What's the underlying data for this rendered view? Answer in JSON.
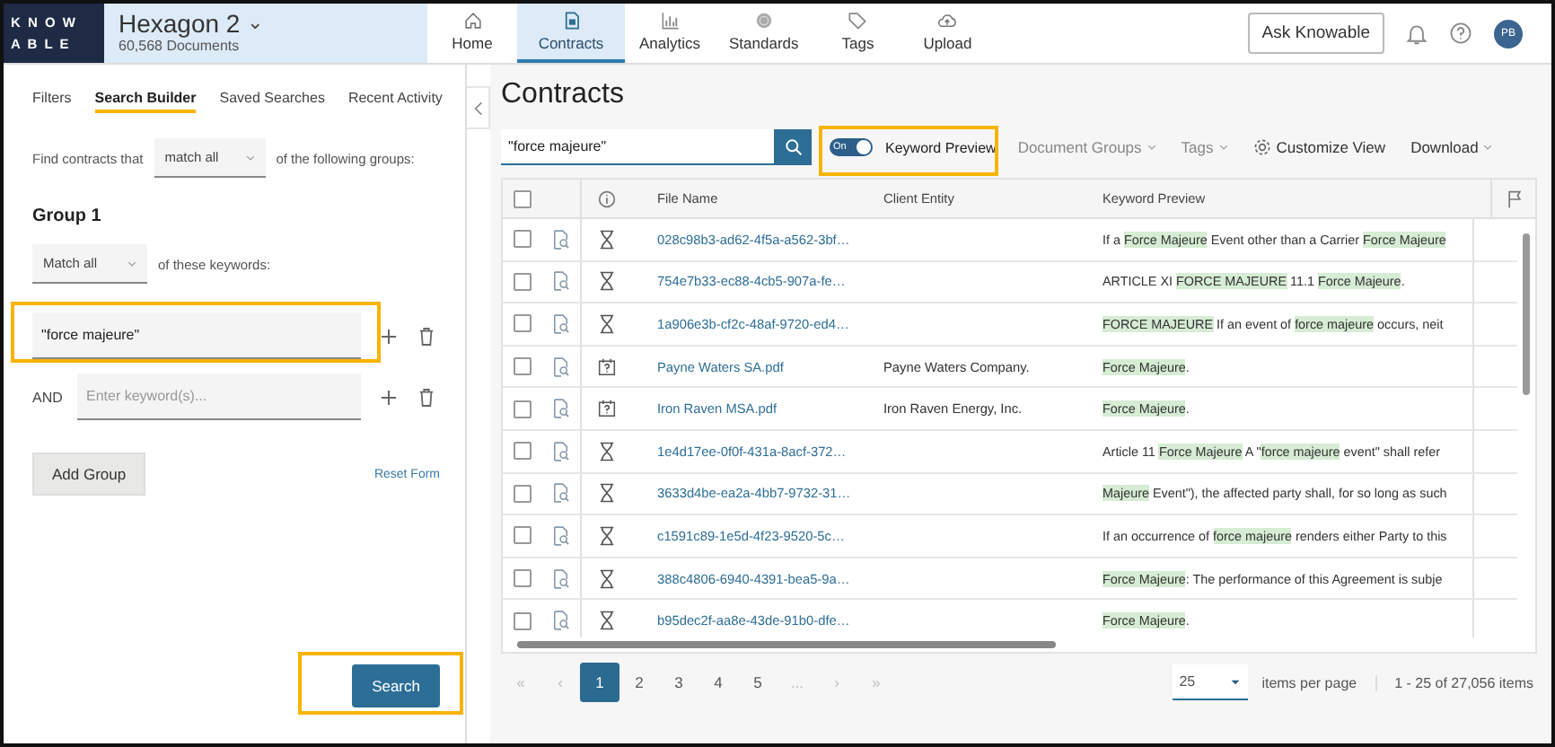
{
  "logo": {
    "line_1": "K N O W",
    "line_2": "A B L E"
  },
  "workspace": {
    "name": "Hexagon 2",
    "caret": "⌄",
    "documents": "60,568 Documents"
  },
  "nav": [
    {
      "label": "Home",
      "selected": false
    },
    {
      "label": "Contracts",
      "selected": true
    },
    {
      "label": "Analytics",
      "selected": false
    },
    {
      "label": "Standards",
      "selected": false
    },
    {
      "label": "Tags",
      "selected": false
    },
    {
      "label": "Upload",
      "selected": false
    }
  ],
  "ask_button": "Ask Knowable",
  "avatar": "PB",
  "left_tabs": [
    {
      "label": "Filters",
      "selected": false
    },
    {
      "label": "Search Builder",
      "selected": true
    },
    {
      "label": "Saved Searches",
      "selected": false
    },
    {
      "label": "Recent Activity",
      "selected": false
    }
  ],
  "find_row": {
    "before": "Find contracts that",
    "select": "match all",
    "after": "of the following groups:"
  },
  "group": {
    "title": "Group 1",
    "match_select": "Match all",
    "match_after": "of these keywords:",
    "keywords": [
      {
        "value": "\"force majeure\"",
        "annotated": true
      },
      {
        "prefix": "AND",
        "placeholder": "Enter keyword(s)..."
      }
    ]
  },
  "add_group": "Add Group",
  "reset_form": "Reset Form",
  "search_button": {
    "label": "Search",
    "annotated": true
  },
  "page_title": "Contracts",
  "search_field": {
    "value": "\"force majeure\""
  },
  "keyword_toggle": {
    "on": true,
    "state_label": "On",
    "label": "Keyword Preview",
    "annotated": true
  },
  "toolbar": [
    {
      "label": "Document Groups",
      "kind": "dropdown"
    },
    {
      "label": "Tags",
      "kind": "dropdown"
    },
    {
      "label": "Customize View",
      "kind": "settings"
    },
    {
      "label": "Download",
      "kind": "dropdown"
    }
  ],
  "table": {
    "columns": [
      "File Name",
      "Client Entity",
      "Keyword Preview"
    ],
    "select_all_checked": false,
    "rows": [
      {
        "kind": "hourglass",
        "checked": false,
        "file": "028c98b3-ad62-4f5a-a562-3bf…",
        "preview": [
          {
            "text": "If a ",
            "highlighted": false
          },
          {
            "text": "Force Majeure",
            "highlighted": true
          },
          {
            "text": " Event other than a Carrier ",
            "highlighted": false
          },
          {
            "text": "Force Majeure",
            "highlighted": true
          }
        ]
      },
      {
        "kind": "hourglass",
        "checked": false,
        "file": "754e7b33-ec88-4cb5-907a-fe…",
        "preview": [
          {
            "text": "ARTICLE XI ",
            "highlighted": false
          },
          {
            "text": "FORCE MAJEURE",
            "highlighted": true
          },
          {
            "text": " 11.1 ",
            "highlighted": false
          },
          {
            "text": "Force Majeure",
            "highlighted": true
          },
          {
            "text": ".",
            "highlighted": false
          }
        ]
      },
      {
        "kind": "hourglass",
        "checked": false,
        "file": "1a906e3b-cf2c-48af-9720-ed4…",
        "preview": [
          {
            "text": "FORCE MAJEURE",
            "highlighted": true
          },
          {
            "text": " If an event of ",
            "highlighted": false
          },
          {
            "text": "force majeure",
            "highlighted": true
          },
          {
            "text": " occurs, neit",
            "highlighted": false
          }
        ]
      },
      {
        "kind": "calendar",
        "checked": false,
        "file": "Payne Waters SA.pdf",
        "client": "Payne Waters Company.",
        "preview": [
          {
            "text": "Force Majeure",
            "highlighted": true
          },
          {
            "text": ".",
            "highlighted": false
          }
        ]
      },
      {
        "kind": "calendar",
        "checked": false,
        "file": "Iron Raven MSA.pdf",
        "client": "Iron Raven Energy, Inc.",
        "preview": [
          {
            "text": "Force Majeure",
            "highlighted": true
          },
          {
            "text": ".",
            "highlighted": false
          }
        ]
      },
      {
        "kind": "hourglass",
        "checked": false,
        "file": "1e4d17ee-0f0f-431a-8acf-372…",
        "preview": [
          {
            "text": "Article 11 ",
            "highlighted": false
          },
          {
            "text": "Force Majeure",
            "highlighted": true
          },
          {
            "text": " A \"",
            "highlighted": false
          },
          {
            "text": "force majeure",
            "highlighted": true
          },
          {
            "text": " event\" shall refer",
            "highlighted": false
          }
        ]
      },
      {
        "kind": "hourglass",
        "checked": false,
        "file": "3633d4be-ea2a-4bb7-9732-31…",
        "preview": [
          {
            "text": "Majeure",
            "highlighted": true
          },
          {
            "text": " Event\"), the affected party shall, for so long as such",
            "highlighted": false
          }
        ]
      },
      {
        "kind": "hourglass",
        "checked": false,
        "file": "c1591c89-1e5d-4f23-9520-5c…",
        "preview": [
          {
            "text": "If an occurrence of ",
            "highlighted": false
          },
          {
            "text": "force majeure",
            "highlighted": true
          },
          {
            "text": " renders either Party to this",
            "highlighted": false
          }
        ]
      },
      {
        "kind": "hourglass",
        "checked": false,
        "file": "388c4806-6940-4391-bea5-9a…",
        "preview": [
          {
            "text": "Force Majeure",
            "highlighted": true
          },
          {
            "text": ": The performance of this Agreement is subje",
            "highlighted": false
          }
        ]
      },
      {
        "kind": "hourglass",
        "checked": false,
        "file": "b95dec2f-aa8e-43de-91b0-dfe…",
        "preview": [
          {
            "text": "Force Majeure",
            "highlighted": true
          },
          {
            "text": ".",
            "highlighted": false
          }
        ]
      }
    ]
  },
  "pagination": {
    "pages": [
      {
        "label": "«",
        "kind": "arrow",
        "selected": false
      },
      {
        "label": "‹",
        "kind": "arrow",
        "selected": false
      },
      {
        "label": "1",
        "kind": "page",
        "selected": true
      },
      {
        "label": "2",
        "kind": "page",
        "selected": false
      },
      {
        "label": "3",
        "kind": "page",
        "selected": false
      },
      {
        "label": "4",
        "kind": "page",
        "selected": false
      },
      {
        "label": "5",
        "kind": "page",
        "selected": false
      },
      {
        "label": "...",
        "kind": "arrow",
        "selected": false
      },
      {
        "label": "›",
        "kind": "arrow",
        "selected": false
      },
      {
        "label": "»",
        "kind": "arrow",
        "selected": false
      }
    ],
    "page_size": "25",
    "per_page_label": "items per page",
    "range": "1 - 25 of 27,056 items"
  }
}
